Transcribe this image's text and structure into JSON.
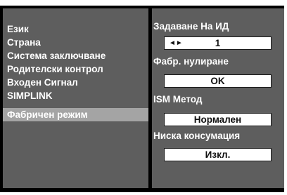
{
  "menu": {
    "items": [
      {
        "label": "Език"
      },
      {
        "label": "Страна"
      },
      {
        "label": "Система заключване"
      },
      {
        "label": "Родителски контрол"
      },
      {
        "label": "Входен Сигнал"
      },
      {
        "label": "SIMPLINK"
      },
      {
        "label": "Фабричен режим",
        "selected": true
      }
    ]
  },
  "settings": {
    "set_id": {
      "label": "Задаване На ИД",
      "value": "1",
      "arrows": "◄►"
    },
    "factory_reset": {
      "label": "Фабр. нулиране",
      "value": "OK"
    },
    "ism_method": {
      "label": "ISM Метод",
      "value": "Нормален"
    },
    "low_power": {
      "label": "Ниска консумация",
      "value": "Изкл."
    }
  }
}
